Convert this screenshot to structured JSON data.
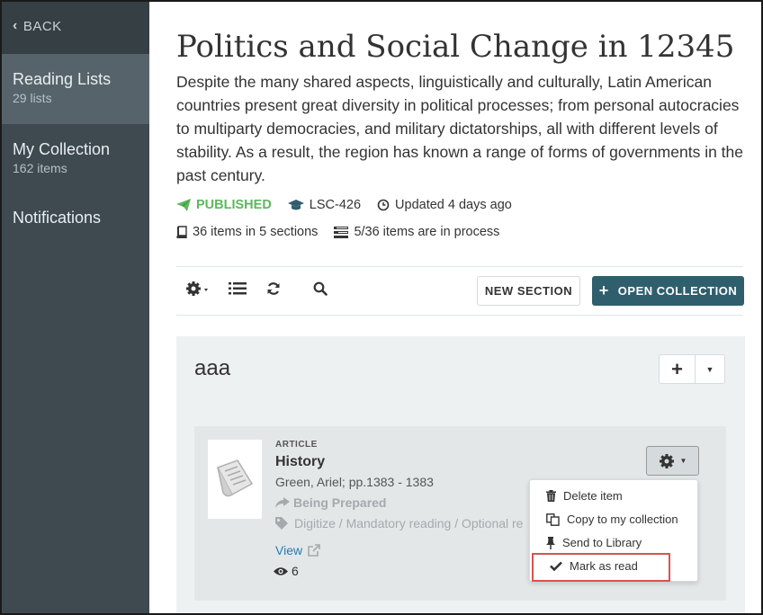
{
  "sidebar": {
    "back_label": "BACK",
    "items": [
      {
        "label": "Reading Lists",
        "sub": "29 lists"
      },
      {
        "label": "My Collection",
        "sub": "162 items"
      },
      {
        "label": "Notifications"
      }
    ]
  },
  "page": {
    "title": "Politics and Social Change in 12345",
    "description": "Despite the many shared aspects, linguistically and culturally, Latin American countries present great diversity in political processes; from personal autocracies to multiparty democracies, and military dictatorships, all with different levels of stability. As a result, the region has known a range of forms of governments in the past century.",
    "status": "PUBLISHED",
    "course_code": "LSC-426",
    "updated": "Updated 4 days ago",
    "items_sections": "36 items in 5 sections",
    "in_process": "5/36 items are in process"
  },
  "toolbar": {
    "new_section": "NEW SECTION",
    "open_collection": "OPEN COLLECTION"
  },
  "section": {
    "title": "aaa",
    "item": {
      "type": "ARTICLE",
      "title": "History",
      "author": "Green, Ariel; pp.1383 - 1383",
      "status": "Being Prepared",
      "tags": "Digitize / Mandatory reading / Optional re",
      "view_label": "View",
      "views": "6"
    }
  },
  "menu": {
    "items": [
      "Delete item",
      "Copy to my collection",
      "Send to Library",
      "Mark as read"
    ]
  },
  "colors": {
    "sidebar": "#3e4a50",
    "sidebar_active": "#56636a",
    "accent": "#2f5f6d",
    "published": "#5cb85c",
    "link": "#2a7ab0",
    "highlight": "#d9534f"
  }
}
